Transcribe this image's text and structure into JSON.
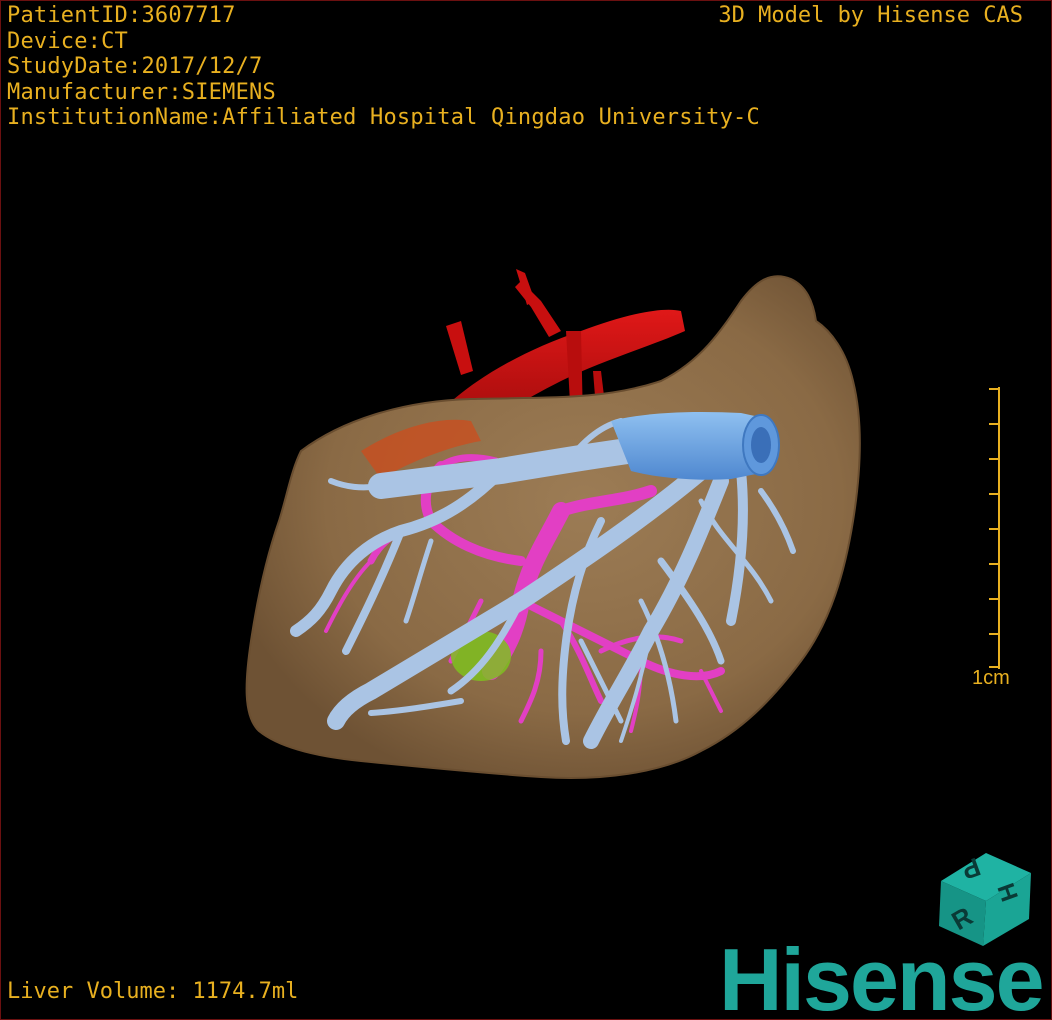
{
  "viewer": {
    "patient_line": "PatientID:3607717",
    "device_line": "Device:CT",
    "study_date_line": "StudyDate:2017/12/7",
    "manufacturer_line": "Manufacturer:SIEMENS",
    "institution_line": "InstitutionName:Affiliated Hospital Qingdao University-C",
    "credit": "3D Model by Hisense CAS",
    "volume_line": "Liver Volume: 1174.7ml",
    "scale_label": "1cm",
    "brand": "Hisense",
    "cube_labels": [
      "H",
      "P",
      "R"
    ]
  },
  "colors": {
    "text": "#e8b020",
    "liver": "#8a6a45",
    "artery": "#c80f0f",
    "portal_vein": "#e23fc4",
    "hepatic_vein": "#aac4e4",
    "ivc": "#6fa8e6",
    "lesion": "#7fc020",
    "brand": "#1fa69a"
  }
}
